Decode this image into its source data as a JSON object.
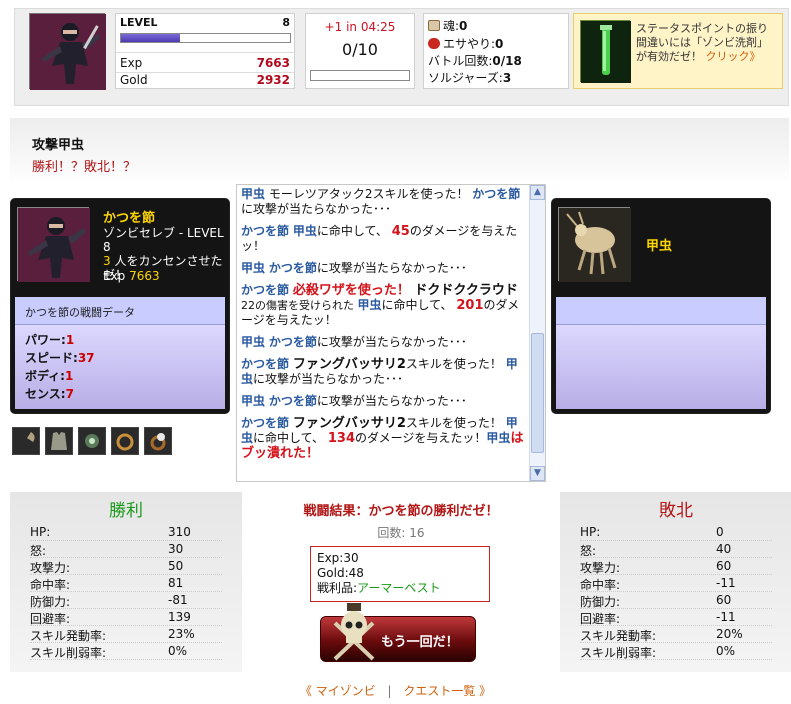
{
  "header": {
    "level_label": "LEVEL",
    "level": "8",
    "level_progress": 0.35,
    "exp_label": "Exp",
    "exp": "7663",
    "gold_label": "Gold",
    "gold": "2932",
    "timer_text": "+1 in 04:25",
    "stamina": "0/10",
    "stamina_progress": 0,
    "items": [
      {
        "label": "魂:",
        "value": "0",
        "icon": "soul-icon"
      },
      {
        "label": "エサやり:",
        "value": "0",
        "icon": "feed-icon"
      },
      {
        "label": "バトル回数:",
        "value": "0/18"
      },
      {
        "label": "ソルジャーズ:",
        "value": "3"
      }
    ],
    "tip_text": "ステータスポイントの振り間違いには「ゾンビ洗剤」が有効だゼ！",
    "tip_link": "クリック》",
    "tip_icon": "potion-icon"
  },
  "quest": {
    "title": "攻撃甲虫",
    "subtitle": "勝利！？敗北！？"
  },
  "player": {
    "name": "かつを節",
    "desc_line": "ゾンビセレブ - LEVEL 8",
    "desc_count": "3",
    "desc_rest": "人をカンセンさせたゼ！",
    "exp_label": "Exp",
    "exp": "7663",
    "data_title": "かつを節の戦闘データ",
    "stats": [
      {
        "label": "パワー:",
        "value": "1"
      },
      {
        "label": "スピード:",
        "value": "37"
      },
      {
        "label": "ボディ:",
        "value": "1"
      },
      {
        "label": "センス:",
        "value": "7"
      }
    ]
  },
  "enemy": {
    "name": "甲虫"
  },
  "log": {
    "e1_a": "甲虫",
    "e1_b": " モーレツアタック2スキルを使った！ ",
    "e1_c": "かつを節",
    "e1_d": "に攻撃が当たらなかった･･･",
    "e2_a": "かつを節",
    "e2_b": " ",
    "e2_c": "甲虫",
    "e2_d": "に命中して、 ",
    "e2_e": "45",
    "e2_f": "のダメージを与えたッ！",
    "e3_a": "甲虫",
    "e3_b": " ",
    "e3_c": "かつを節",
    "e3_d": "に攻撃が当たらなかった･･･",
    "e4_a": "かつを節",
    "e4_b": " ",
    "e4_c": "必殺ワザを使った！",
    "e4_d": " ドクドククラウド",
    "e4_e": " 22の傷害を受けられた ",
    "e4_f": "甲虫",
    "e4_g": "に命中して、 ",
    "e4_h": "201",
    "e4_i": "のダメージを与えたッ！",
    "e5_a": "甲虫",
    "e5_b": " ",
    "e5_c": "かつを節",
    "e5_d": "に攻撃が当たらなかった･･･",
    "e6_a": "かつを節",
    "e6_b": " ",
    "e6_c": "ファングバッサリ2",
    "e6_d": "スキルを使った！ ",
    "e6_e": "甲虫",
    "e6_f": "に攻撃が当たらなかった･･･",
    "e7_a": "甲虫",
    "e7_b": " ",
    "e7_c": "かつを節",
    "e7_d": "に攻撃が当たらなかった･･･",
    "e8_a": "かつを節",
    "e8_b": " ",
    "e8_c": "ファングバッサリ2",
    "e8_d": "スキルを使った！ ",
    "e8_e": "甲虫",
    "e8_f": "に命中して、 ",
    "e8_g": "134",
    "e8_h": "のダメージを与えたッ！",
    "e8_i": "甲虫",
    "e8_j": "はブッ潰れた！"
  },
  "results": {
    "win_title": "勝利",
    "lose_title": "敗北",
    "rows": [
      "HP:",
      "怒:",
      "攻撃力:",
      "命中率:",
      "防御力:",
      "回避率:",
      "スキル発動率:",
      "スキル削弱率:"
    ],
    "win_values": [
      "310",
      "30",
      "50",
      "81",
      "-81",
      "139",
      "23%",
      "0%"
    ],
    "lose_values": [
      "0",
      "40",
      "60",
      "-11",
      "60",
      "-11",
      "20%",
      "0%"
    ],
    "battle_result": "戦闘結果：かつを節の勝利だゼ！",
    "turns_label": "回数:",
    "turns": "16",
    "reward_exp_label": "Exp:",
    "reward_exp": "30",
    "reward_gold_label": "Gold:",
    "reward_gold": "48",
    "reward_loot_label": "戦利品:",
    "reward_loot": "アーマーベスト",
    "retry_label": "もう一回だ！"
  },
  "footer": {
    "my_zombie": "《 マイゾンビ",
    "sep": "|",
    "quest_list": "クエスト一覧 》"
  },
  "colors": {
    "accent_red": "#b11515",
    "link_blue": "#2a5aa0",
    "win_green": "#1a9a1a",
    "gold_yellow": "#ffd700"
  }
}
